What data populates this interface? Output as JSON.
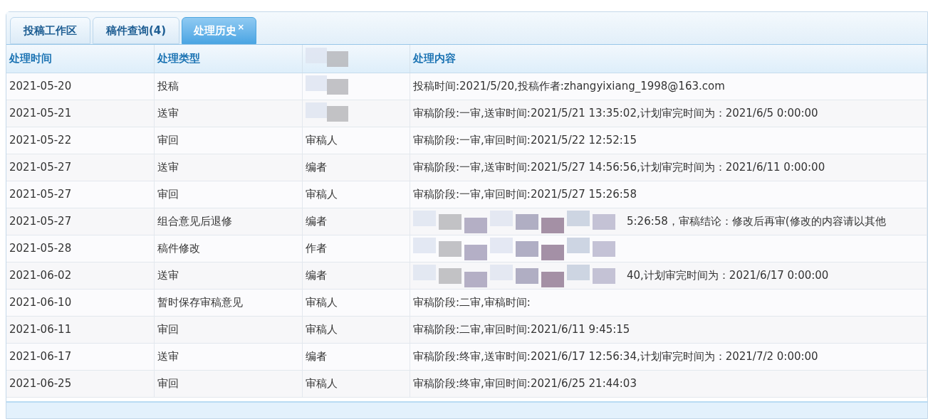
{
  "tabs": [
    {
      "label": "投稿工作区",
      "selected": false,
      "closable": false
    },
    {
      "label": "稿件查询(4)",
      "selected": false,
      "closable": false
    },
    {
      "label": "处理历史",
      "selected": true,
      "closable": true
    }
  ],
  "close_glyph": "×",
  "table": {
    "columns": [
      {
        "label": "处理时间"
      },
      {
        "label": "处理类型"
      },
      {
        "redacted": true
      },
      {
        "label": "处理内容"
      }
    ],
    "rows": [
      {
        "cells": [
          {
            "text": "2021-05-20"
          },
          {
            "text": "投稿"
          },
          {
            "redacted": true
          },
          {
            "text": "投稿时间:2021/5/20,投稿作者:zhangyixiang_1998@163.com"
          }
        ]
      },
      {
        "cells": [
          {
            "text": "2021-05-21"
          },
          {
            "text": "送审"
          },
          {
            "redacted": true
          },
          {
            "text": "审稿阶段:一审,送审时间:2021/5/21 13:35:02,计划审完时间为：2021/6/5 0:00:00"
          }
        ]
      },
      {
        "cells": [
          {
            "text": "2021-05-22"
          },
          {
            "text": "审回"
          },
          {
            "text": "审稿人"
          },
          {
            "text": "审稿阶段:一审,审回时间:2021/5/22 12:52:15"
          }
        ]
      },
      {
        "cells": [
          {
            "text": "2021-05-27"
          },
          {
            "text": "送审"
          },
          {
            "text": "编者"
          },
          {
            "text": "审稿阶段:一审,送审时间:2021/5/27 14:56:56,计划审完时间为：2021/6/11 0:00:00"
          }
        ]
      },
      {
        "cells": [
          {
            "text": "2021-05-27"
          },
          {
            "text": "审回"
          },
          {
            "text": "审稿人"
          },
          {
            "text": "审稿阶段:一审,审回时间:2021/5/27 15:26:58"
          }
        ]
      },
      {
        "cells": [
          {
            "text": "2021-05-27"
          },
          {
            "text": "组合意见后退修"
          },
          {
            "text": "编者"
          },
          {
            "text": "5:26:58，审稿结论：修改后再审(修改的内容请以其他",
            "redacted": true
          }
        ]
      },
      {
        "cells": [
          {
            "text": "2021-05-28"
          },
          {
            "text": "稿件修改"
          },
          {
            "text": "作者"
          },
          {
            "redacted": true
          }
        ]
      },
      {
        "cells": [
          {
            "text": "2021-06-02"
          },
          {
            "text": "送审"
          },
          {
            "text": "编者"
          },
          {
            "text": "40,计划审完时间为：2021/6/17 0:00:00",
            "redacted": true
          }
        ]
      },
      {
        "cells": [
          {
            "text": "2021-06-10"
          },
          {
            "text": "暂时保存审稿意见"
          },
          {
            "text": "审稿人"
          },
          {
            "text": "审稿阶段:二审,审稿时间:"
          }
        ]
      },
      {
        "cells": [
          {
            "text": "2021-06-11"
          },
          {
            "text": "审回"
          },
          {
            "text": "审稿人"
          },
          {
            "text": "审稿阶段:二审,审回时间:2021/6/11 9:45:15"
          }
        ]
      },
      {
        "cells": [
          {
            "text": "2021-06-17"
          },
          {
            "text": "送审"
          },
          {
            "text": "编者"
          },
          {
            "text": "审稿阶段:终审,送审时间:2021/6/17 12:56:34,计划审完时间为：2021/7/2 0:00:00"
          }
        ]
      },
      {
        "cells": [
          {
            "text": "2021-06-25"
          },
          {
            "text": "审回"
          },
          {
            "text": "审稿人"
          },
          {
            "text": "审稿阶段:终审,审回时间:2021/6/25 21:44:03"
          }
        ]
      }
    ]
  }
}
